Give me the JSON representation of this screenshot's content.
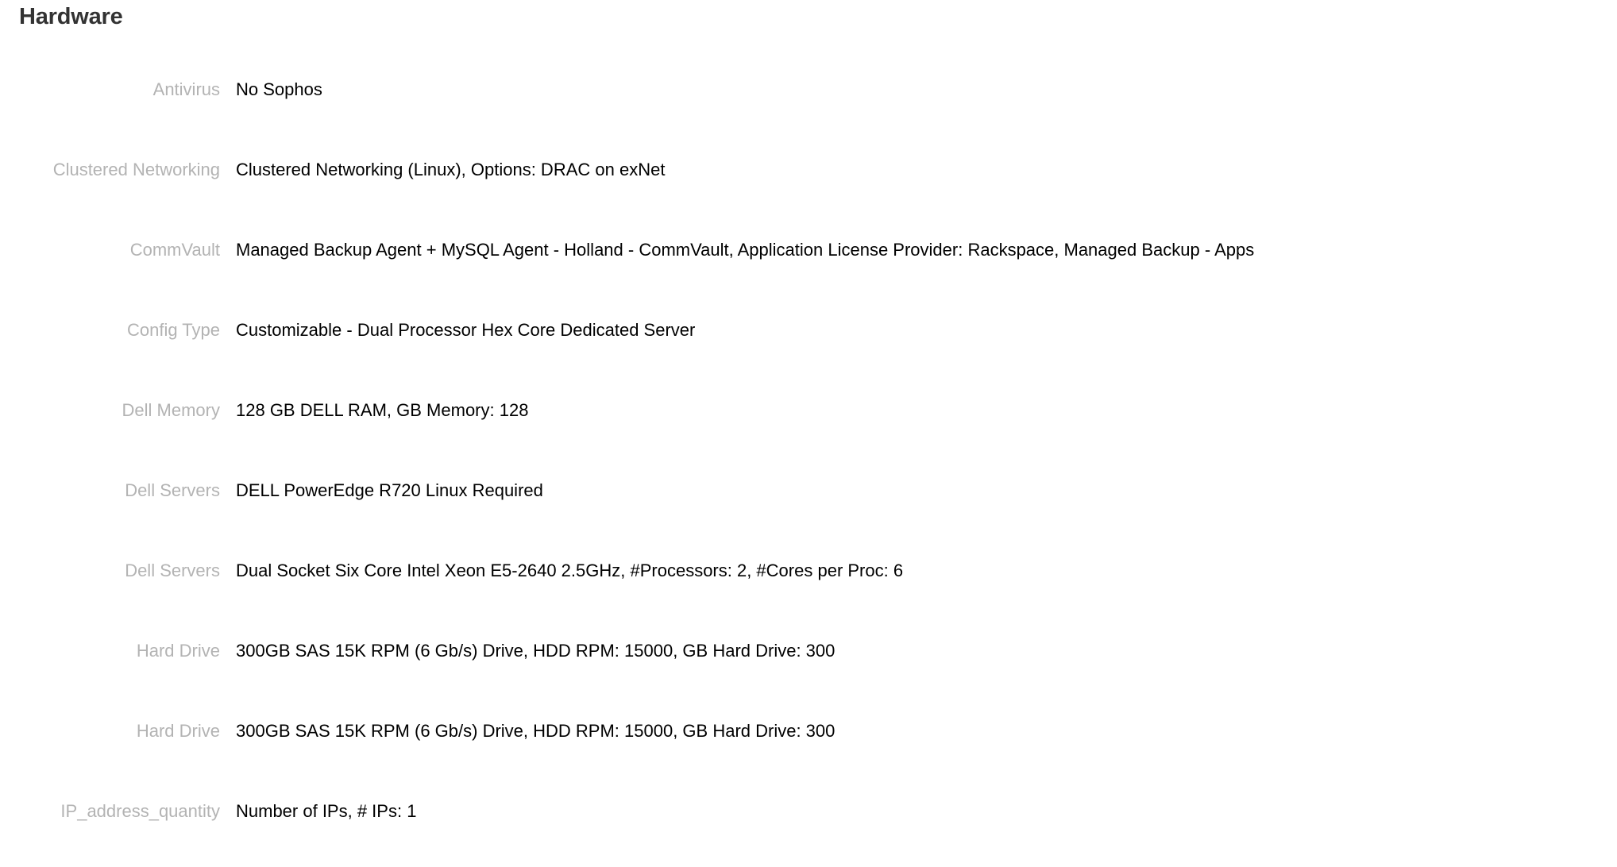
{
  "header": {
    "title": "Hardware"
  },
  "colors": {
    "background": "#ffffff",
    "title_text": "#333333",
    "label_text": "#b3b3b3",
    "value_text": "#000000"
  },
  "spec_list": {
    "rows": [
      {
        "label": "Antivirus",
        "value": "No Sophos"
      },
      {
        "label": "Clustered Networking",
        "value": "Clustered Networking (Linux), Options: DRAC on exNet"
      },
      {
        "label": "CommVault",
        "value": "Managed Backup Agent + MySQL Agent - Holland - CommVault, Application License Provider: Rackspace, Managed Backup - Apps"
      },
      {
        "label": "Config Type",
        "value": "Customizable - Dual Processor Hex Core Dedicated Server"
      },
      {
        "label": "Dell Memory",
        "value": "128 GB DELL RAM, GB Memory: 128"
      },
      {
        "label": "Dell Servers",
        "value": "DELL PowerEdge R720 Linux Required"
      },
      {
        "label": "Dell Servers",
        "value": "Dual Socket Six Core Intel Xeon E5-2640 2.5GHz, #Processors: 2, #Cores per Proc: 6"
      },
      {
        "label": "Hard Drive",
        "value": "300GB SAS 15K RPM (6 Gb/s) Drive, HDD RPM: 15000, GB Hard Drive: 300"
      },
      {
        "label": "Hard Drive",
        "value": "300GB SAS 15K RPM (6 Gb/s) Drive, HDD RPM: 15000, GB Hard Drive: 300"
      },
      {
        "label": "IP_address_quantity",
        "value": "Number of IPs, # IPs: 1"
      }
    ]
  }
}
